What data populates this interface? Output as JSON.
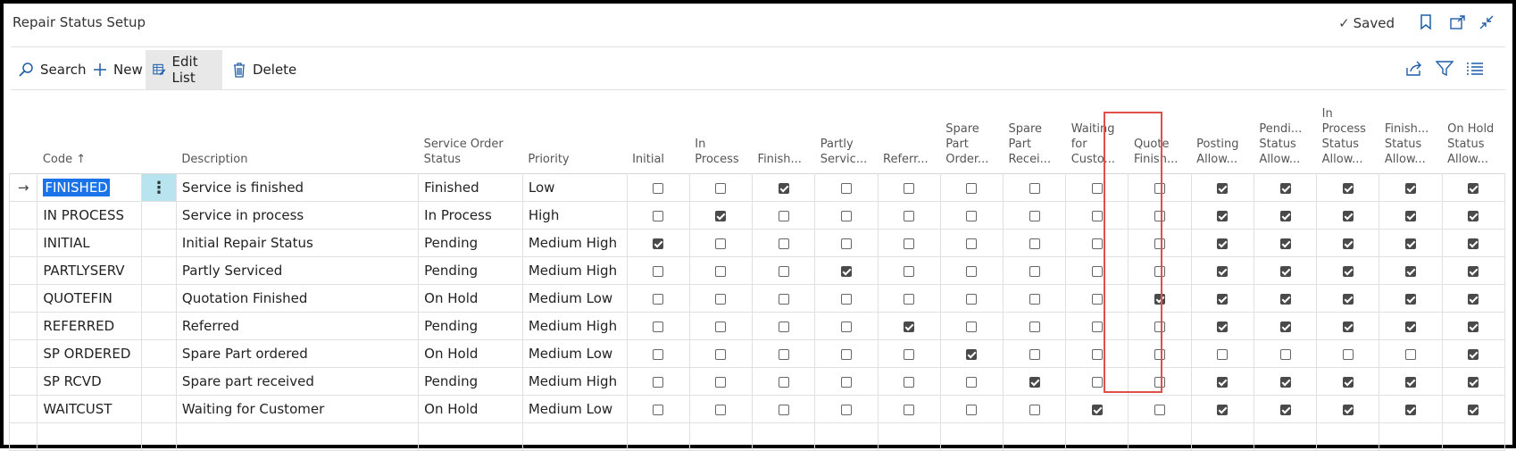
{
  "window": {
    "title": "Repair Status Setup",
    "saved_label": "Saved",
    "icons": [
      "bookmark-icon",
      "open-new-window-icon",
      "collapse-icon"
    ]
  },
  "actions": {
    "search": "Search",
    "new": "New",
    "edit_list": "Edit List",
    "delete": "Delete",
    "right_icons": [
      "share-icon",
      "filter-icon",
      "list-view-icon"
    ]
  },
  "table": {
    "columns": {
      "code": "Code",
      "description": "Description",
      "service_order_status": "Service Order Status",
      "priority": "Priority",
      "initial": "Initial",
      "in_process": "In Process",
      "finished": "Finish...",
      "partly_serviced": "Partly Servic...",
      "referred": "Referr...",
      "spare_part_ordered": "Spare Part Order...",
      "spare_part_received": "Spare Part Recei...",
      "waiting_for_customer": "Waiting for Custo...",
      "quote_finished": "Quote Finish...",
      "posting_allowed": "Posting Allow...",
      "pending_status_allowed": "Pendi... Status Allow...",
      "in_process_status_allowed": "In Process Status Allow...",
      "finished_status_allowed": "Finish... Status Allow...",
      "on_hold_status_allowed": "On Hold Status Allow..."
    },
    "rows": [
      {
        "code": "FINISHED",
        "description": "Service is finished",
        "status": "Finished",
        "priority": "Low",
        "flags": [
          0,
          0,
          1,
          0,
          0,
          0,
          0,
          0,
          0,
          1,
          1,
          1,
          1,
          1
        ]
      },
      {
        "code": "IN PROCESS",
        "description": "Service in process",
        "status": "In Process",
        "priority": "High",
        "flags": [
          0,
          1,
          0,
          0,
          0,
          0,
          0,
          0,
          0,
          1,
          1,
          1,
          1,
          1
        ]
      },
      {
        "code": "INITIAL",
        "description": "Initial Repair Status",
        "status": "Pending",
        "priority": "Medium High",
        "flags": [
          1,
          0,
          0,
          0,
          0,
          0,
          0,
          0,
          0,
          1,
          1,
          1,
          1,
          1
        ]
      },
      {
        "code": "PARTLYSERV",
        "description": "Partly Serviced",
        "status": "Pending",
        "priority": "Medium High",
        "flags": [
          0,
          0,
          0,
          1,
          0,
          0,
          0,
          0,
          0,
          1,
          1,
          1,
          1,
          1
        ]
      },
      {
        "code": "QUOTEFIN",
        "description": "Quotation Finished",
        "status": "On Hold",
        "priority": "Medium Low",
        "flags": [
          0,
          0,
          0,
          0,
          0,
          0,
          0,
          0,
          1,
          1,
          1,
          1,
          1,
          1
        ]
      },
      {
        "code": "REFERRED",
        "description": "Referred",
        "status": "Pending",
        "priority": "Medium High",
        "flags": [
          0,
          0,
          0,
          0,
          1,
          0,
          0,
          0,
          0,
          1,
          1,
          1,
          1,
          1
        ]
      },
      {
        "code": "SP ORDERED",
        "description": "Spare Part ordered",
        "status": "On Hold",
        "priority": "Medium Low",
        "flags": [
          0,
          0,
          0,
          0,
          0,
          1,
          0,
          0,
          0,
          0,
          0,
          0,
          0,
          1
        ]
      },
      {
        "code": "SP RCVD",
        "description": "Spare part received",
        "status": "Pending",
        "priority": "Medium High",
        "flags": [
          0,
          0,
          0,
          0,
          0,
          0,
          1,
          0,
          0,
          1,
          1,
          1,
          1,
          1
        ]
      },
      {
        "code": "WAITCUST",
        "description": "Waiting for Customer",
        "status": "On Hold",
        "priority": "Medium Low",
        "flags": [
          0,
          0,
          0,
          0,
          0,
          0,
          0,
          1,
          0,
          1,
          1,
          1,
          1,
          1
        ]
      }
    ]
  },
  "colors": {
    "accent": "#1f5da8",
    "highlight_border": "#e0504a",
    "selected_dots_bg": "#b7e4ee"
  }
}
